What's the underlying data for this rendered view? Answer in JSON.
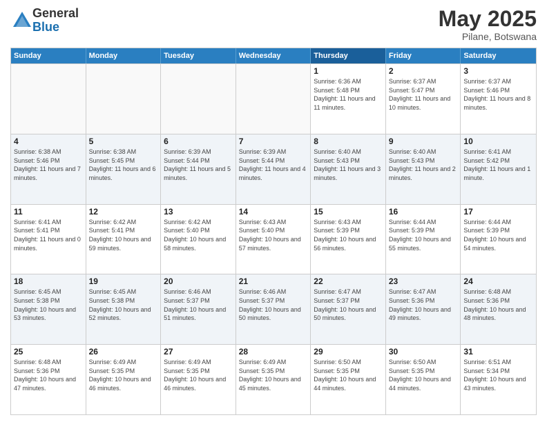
{
  "logo": {
    "general": "General",
    "blue": "Blue"
  },
  "title": "May 2025",
  "location": "Pilane, Botswana",
  "days_of_week": [
    "Sunday",
    "Monday",
    "Tuesday",
    "Wednesday",
    "Thursday",
    "Friday",
    "Saturday"
  ],
  "weeks": [
    [
      {
        "day": "",
        "info": "",
        "empty": true
      },
      {
        "day": "",
        "info": "",
        "empty": true
      },
      {
        "day": "",
        "info": "",
        "empty": true
      },
      {
        "day": "",
        "info": "",
        "empty": true
      },
      {
        "day": "1",
        "info": "Sunrise: 6:36 AM\nSunset: 5:48 PM\nDaylight: 11 hours and 11 minutes."
      },
      {
        "day": "2",
        "info": "Sunrise: 6:37 AM\nSunset: 5:47 PM\nDaylight: 11 hours and 10 minutes."
      },
      {
        "day": "3",
        "info": "Sunrise: 6:37 AM\nSunset: 5:46 PM\nDaylight: 11 hours and 8 minutes."
      }
    ],
    [
      {
        "day": "4",
        "info": "Sunrise: 6:38 AM\nSunset: 5:46 PM\nDaylight: 11 hours and 7 minutes."
      },
      {
        "day": "5",
        "info": "Sunrise: 6:38 AM\nSunset: 5:45 PM\nDaylight: 11 hours and 6 minutes."
      },
      {
        "day": "6",
        "info": "Sunrise: 6:39 AM\nSunset: 5:44 PM\nDaylight: 11 hours and 5 minutes."
      },
      {
        "day": "7",
        "info": "Sunrise: 6:39 AM\nSunset: 5:44 PM\nDaylight: 11 hours and 4 minutes."
      },
      {
        "day": "8",
        "info": "Sunrise: 6:40 AM\nSunset: 5:43 PM\nDaylight: 11 hours and 3 minutes."
      },
      {
        "day": "9",
        "info": "Sunrise: 6:40 AM\nSunset: 5:43 PM\nDaylight: 11 hours and 2 minutes."
      },
      {
        "day": "10",
        "info": "Sunrise: 6:41 AM\nSunset: 5:42 PM\nDaylight: 11 hours and 1 minute."
      }
    ],
    [
      {
        "day": "11",
        "info": "Sunrise: 6:41 AM\nSunset: 5:41 PM\nDaylight: 11 hours and 0 minutes."
      },
      {
        "day": "12",
        "info": "Sunrise: 6:42 AM\nSunset: 5:41 PM\nDaylight: 10 hours and 59 minutes."
      },
      {
        "day": "13",
        "info": "Sunrise: 6:42 AM\nSunset: 5:40 PM\nDaylight: 10 hours and 58 minutes."
      },
      {
        "day": "14",
        "info": "Sunrise: 6:43 AM\nSunset: 5:40 PM\nDaylight: 10 hours and 57 minutes."
      },
      {
        "day": "15",
        "info": "Sunrise: 6:43 AM\nSunset: 5:39 PM\nDaylight: 10 hours and 56 minutes."
      },
      {
        "day": "16",
        "info": "Sunrise: 6:44 AM\nSunset: 5:39 PM\nDaylight: 10 hours and 55 minutes."
      },
      {
        "day": "17",
        "info": "Sunrise: 6:44 AM\nSunset: 5:39 PM\nDaylight: 10 hours and 54 minutes."
      }
    ],
    [
      {
        "day": "18",
        "info": "Sunrise: 6:45 AM\nSunset: 5:38 PM\nDaylight: 10 hours and 53 minutes."
      },
      {
        "day": "19",
        "info": "Sunrise: 6:45 AM\nSunset: 5:38 PM\nDaylight: 10 hours and 52 minutes."
      },
      {
        "day": "20",
        "info": "Sunrise: 6:46 AM\nSunset: 5:37 PM\nDaylight: 10 hours and 51 minutes."
      },
      {
        "day": "21",
        "info": "Sunrise: 6:46 AM\nSunset: 5:37 PM\nDaylight: 10 hours and 50 minutes."
      },
      {
        "day": "22",
        "info": "Sunrise: 6:47 AM\nSunset: 5:37 PM\nDaylight: 10 hours and 50 minutes."
      },
      {
        "day": "23",
        "info": "Sunrise: 6:47 AM\nSunset: 5:36 PM\nDaylight: 10 hours and 49 minutes."
      },
      {
        "day": "24",
        "info": "Sunrise: 6:48 AM\nSunset: 5:36 PM\nDaylight: 10 hours and 48 minutes."
      }
    ],
    [
      {
        "day": "25",
        "info": "Sunrise: 6:48 AM\nSunset: 5:36 PM\nDaylight: 10 hours and 47 minutes."
      },
      {
        "day": "26",
        "info": "Sunrise: 6:49 AM\nSunset: 5:35 PM\nDaylight: 10 hours and 46 minutes."
      },
      {
        "day": "27",
        "info": "Sunrise: 6:49 AM\nSunset: 5:35 PM\nDaylight: 10 hours and 46 minutes."
      },
      {
        "day": "28",
        "info": "Sunrise: 6:49 AM\nSunset: 5:35 PM\nDaylight: 10 hours and 45 minutes."
      },
      {
        "day": "29",
        "info": "Sunrise: 6:50 AM\nSunset: 5:35 PM\nDaylight: 10 hours and 44 minutes."
      },
      {
        "day": "30",
        "info": "Sunrise: 6:50 AM\nSunset: 5:35 PM\nDaylight: 10 hours and 44 minutes."
      },
      {
        "day": "31",
        "info": "Sunrise: 6:51 AM\nSunset: 5:34 PM\nDaylight: 10 hours and 43 minutes."
      }
    ]
  ]
}
